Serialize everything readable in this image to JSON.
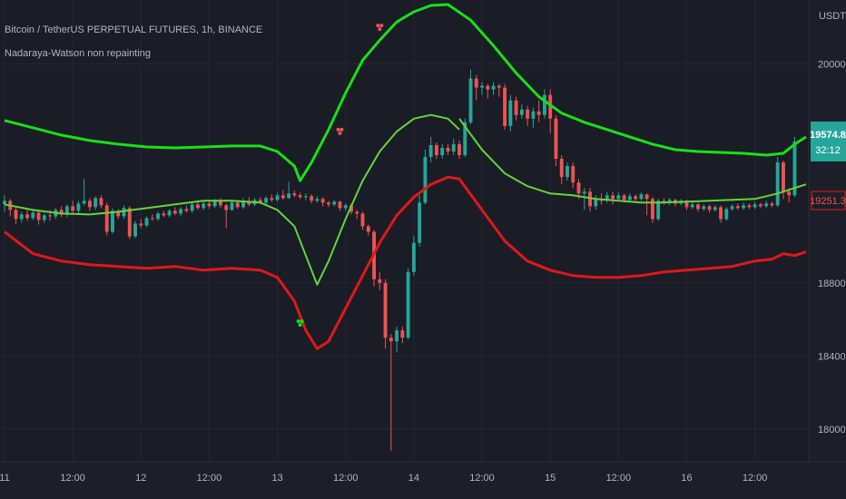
{
  "header": {
    "symbol_line": "Bitcoin / TetherUS PERPETUAL FUTURES, 1h, BINANCE",
    "indicator_name": "Nadaraya-Watson non repainting"
  },
  "price_axis": {
    "unit": "USDT",
    "ticks": [
      "20000.0",
      "18800.0",
      "18400.0",
      "18000.0"
    ],
    "tick_values": [
      20000,
      18800,
      18400,
      18000
    ],
    "last_price": "19574.8",
    "countdown": "32:12",
    "band_price": "19251.3"
  },
  "time_axis": {
    "labels": [
      "11",
      "12:00",
      "12",
      "12:00",
      "13",
      "12:00",
      "14",
      "12:00",
      "15",
      "12:00",
      "16",
      "12:00"
    ],
    "day_index": [
      0,
      12,
      24,
      36,
      48,
      60,
      72,
      84,
      96,
      108,
      120,
      132
    ]
  },
  "colors": {
    "background": "#1a1d26",
    "up_candle": "#26a69a",
    "down_candle": "#ef5350",
    "upper_band": "#18e018",
    "lower_band": "#e01818",
    "mid_line": "#61d63a",
    "last_price_badge": "#26a69a",
    "band_price_badge": "#e01818"
  },
  "chart_data": {
    "type": "candlestick",
    "ylim": [
      17820,
      20350
    ],
    "x_hours": [
      0,
      141
    ],
    "series": [
      {
        "name": "",
        "role": "upper",
        "points": [
          [
            0,
            19690
          ],
          [
            5,
            19650
          ],
          [
            10,
            19610
          ],
          [
            15,
            19580
          ],
          [
            20,
            19560
          ],
          [
            25,
            19545
          ],
          [
            30,
            19540
          ],
          [
            35,
            19545
          ],
          [
            40,
            19550
          ],
          [
            45,
            19550
          ],
          [
            48,
            19520
          ],
          [
            51,
            19440
          ],
          [
            52,
            19360
          ],
          [
            54,
            19460
          ],
          [
            57,
            19640
          ],
          [
            60,
            19840
          ],
          [
            63,
            20020
          ],
          [
            66,
            20130
          ],
          [
            69,
            20230
          ],
          [
            72,
            20285
          ],
          [
            75,
            20320
          ],
          [
            78,
            20325
          ],
          [
            82,
            20240
          ],
          [
            86,
            20100
          ],
          [
            90,
            19950
          ],
          [
            94,
            19820
          ],
          [
            98,
            19730
          ],
          [
            102,
            19680
          ],
          [
            106,
            19640
          ],
          [
            110,
            19600
          ],
          [
            114,
            19560
          ],
          [
            118,
            19530
          ],
          [
            122,
            19520
          ],
          [
            126,
            19515
          ],
          [
            130,
            19510
          ],
          [
            134,
            19500
          ],
          [
            137,
            19510
          ],
          [
            139,
            19560
          ],
          [
            141,
            19600
          ]
        ]
      },
      {
        "name": "",
        "role": "lower",
        "points": [
          [
            0,
            19080
          ],
          [
            5,
            18960
          ],
          [
            10,
            18920
          ],
          [
            15,
            18900
          ],
          [
            20,
            18890
          ],
          [
            25,
            18880
          ],
          [
            30,
            18890
          ],
          [
            35,
            18870
          ],
          [
            40,
            18880
          ],
          [
            45,
            18870
          ],
          [
            48,
            18830
          ],
          [
            51,
            18700
          ],
          [
            53,
            18540
          ],
          [
            55,
            18440
          ],
          [
            57,
            18480
          ],
          [
            60,
            18660
          ],
          [
            63,
            18840
          ],
          [
            66,
            19020
          ],
          [
            69,
            19170
          ],
          [
            72,
            19270
          ],
          [
            75,
            19340
          ],
          [
            78,
            19380
          ],
          [
            80,
            19370
          ],
          [
            84,
            19200
          ],
          [
            88,
            19030
          ],
          [
            92,
            18920
          ],
          [
            96,
            18870
          ],
          [
            100,
            18840
          ],
          [
            104,
            18830
          ],
          [
            108,
            18830
          ],
          [
            112,
            18840
          ],
          [
            116,
            18860
          ],
          [
            120,
            18870
          ],
          [
            124,
            18880
          ],
          [
            128,
            18890
          ],
          [
            132,
            18920
          ],
          [
            135,
            18930
          ],
          [
            137,
            18960
          ],
          [
            139,
            18950
          ],
          [
            141,
            18970
          ]
        ]
      },
      {
        "name": "",
        "role": "mid",
        "points": [
          [
            0,
            19230
          ],
          [
            5,
            19200
          ],
          [
            10,
            19180
          ],
          [
            15,
            19175
          ],
          [
            20,
            19190
          ],
          [
            25,
            19210
          ],
          [
            30,
            19230
          ],
          [
            35,
            19250
          ],
          [
            40,
            19250
          ],
          [
            45,
            19240
          ],
          [
            48,
            19200
          ],
          [
            51,
            19110
          ],
          [
            53,
            18950
          ],
          [
            55,
            18790
          ],
          [
            57,
            18920
          ],
          [
            60,
            19150
          ],
          [
            63,
            19360
          ],
          [
            66,
            19520
          ],
          [
            69,
            19630
          ],
          [
            72,
            19700
          ],
          [
            75,
            19720
          ],
          [
            78,
            19700
          ],
          [
            80,
            19640
          ]
        ]
      },
      {
        "name": "",
        "role": "mid",
        "points": [
          [
            80,
            19700
          ],
          [
            84,
            19530
          ],
          [
            88,
            19400
          ],
          [
            92,
            19330
          ],
          [
            96,
            19290
          ],
          [
            100,
            19280
          ],
          [
            104,
            19260
          ],
          [
            108,
            19250
          ],
          [
            112,
            19240
          ],
          [
            116,
            19240
          ],
          [
            120,
            19245
          ],
          [
            124,
            19250
          ],
          [
            128,
            19255
          ],
          [
            132,
            19260
          ],
          [
            136,
            19290
          ],
          [
            139,
            19320
          ],
          [
            141,
            19340
          ]
        ]
      }
    ],
    "candles": [
      [
        19232,
        19250,
        19280,
        19190
      ],
      [
        19250,
        19200,
        19260,
        19165
      ],
      [
        19200,
        19150,
        19220,
        19120
      ],
      [
        19150,
        19175,
        19190,
        19130
      ],
      [
        19175,
        19155,
        19210,
        19140
      ],
      [
        19155,
        19185,
        19200,
        19145
      ],
      [
        19185,
        19145,
        19195,
        19120
      ],
      [
        19145,
        19170,
        19180,
        19130
      ],
      [
        19170,
        19165,
        19200,
        19140
      ],
      [
        19165,
        19200,
        19210,
        19150
      ],
      [
        19200,
        19175,
        19220,
        19160
      ],
      [
        19175,
        19220,
        19230,
        19160
      ],
      [
        19220,
        19195,
        19250,
        19180
      ],
      [
        19195,
        19235,
        19250,
        19180
      ],
      [
        19235,
        19250,
        19370,
        19225
      ],
      [
        19250,
        19215,
        19265,
        19195
      ],
      [
        19215,
        19265,
        19275,
        19200
      ],
      [
        19265,
        19225,
        19280,
        19210
      ],
      [
        19225,
        19080,
        19240,
        19060
      ],
      [
        19080,
        19195,
        19210,
        19070
      ],
      [
        19195,
        19165,
        19205,
        19150
      ],
      [
        19165,
        19210,
        19225,
        19150
      ],
      [
        19210,
        19055,
        19220,
        19040
      ],
      [
        19055,
        19125,
        19140,
        19045
      ],
      [
        19125,
        19115,
        19150,
        19100
      ],
      [
        19115,
        19155,
        19165,
        19105
      ],
      [
        19155,
        19150,
        19175,
        19140
      ],
      [
        19150,
        19180,
        19190,
        19140
      ],
      [
        19180,
        19170,
        19195,
        19160
      ],
      [
        19170,
        19195,
        19205,
        19160
      ],
      [
        19195,
        19180,
        19215,
        19170
      ],
      [
        19180,
        19205,
        19215,
        19165
      ],
      [
        19205,
        19195,
        19225,
        19185
      ],
      [
        19195,
        19230,
        19240,
        19185
      ],
      [
        19230,
        19210,
        19245,
        19200
      ],
      [
        19210,
        19235,
        19250,
        19200
      ],
      [
        19235,
        19220,
        19255,
        19205
      ],
      [
        19220,
        19250,
        19260,
        19210
      ],
      [
        19250,
        19225,
        19265,
        19210
      ],
      [
        19225,
        19200,
        19235,
        19100
      ],
      [
        19200,
        19240,
        19250,
        19195
      ],
      [
        19240,
        19215,
        19255,
        19205
      ],
      [
        19215,
        19250,
        19265,
        19205
      ],
      [
        19250,
        19230,
        19270,
        19220
      ],
      [
        19230,
        19255,
        19265,
        19220
      ],
      [
        19255,
        19240,
        19270,
        19230
      ],
      [
        19240,
        19265,
        19275,
        19230
      ],
      [
        19265,
        19255,
        19285,
        19245
      ],
      [
        19255,
        19280,
        19295,
        19245
      ],
      [
        19280,
        19265,
        19310,
        19255
      ],
      [
        19265,
        19290,
        19355,
        19260
      ],
      [
        19290,
        19280,
        19305,
        19270
      ],
      [
        19280,
        19270,
        19295,
        19260
      ],
      [
        19270,
        19275,
        19290,
        19255
      ],
      [
        19275,
        19250,
        19285,
        19235
      ],
      [
        19250,
        19260,
        19275,
        19240
      ],
      [
        19260,
        19240,
        19270,
        19220
      ],
      [
        19240,
        19230,
        19250,
        19215
      ],
      [
        19230,
        19245,
        19255,
        19220
      ],
      [
        19245,
        19210,
        19250,
        19195
      ],
      [
        19210,
        19225,
        19235,
        19195
      ],
      [
        19225,
        19190,
        19235,
        19175
      ],
      [
        19190,
        19180,
        19200,
        19150
      ],
      [
        19180,
        19110,
        19190,
        19090
      ],
      [
        19110,
        19080,
        19120,
        19060
      ],
      [
        19080,
        18820,
        19090,
        18780
      ],
      [
        18820,
        18800,
        18860,
        18760
      ],
      [
        18800,
        18500,
        18820,
        18440
      ],
      [
        18500,
        18480,
        18520,
        17880
      ],
      [
        18480,
        18540,
        18560,
        18420
      ],
      [
        18540,
        18500,
        18560,
        18470
      ],
      [
        18500,
        18860,
        18880,
        18490
      ],
      [
        18860,
        19020,
        19060,
        18840
      ],
      [
        19020,
        19240,
        19280,
        19000
      ],
      [
        19240,
        19490,
        19530,
        19230
      ],
      [
        19490,
        19555,
        19600,
        19460
      ],
      [
        19555,
        19500,
        19570,
        19480
      ],
      [
        19500,
        19540,
        19560,
        19480
      ],
      [
        19540,
        19520,
        19560,
        19500
      ],
      [
        19520,
        19560,
        19590,
        19500
      ],
      [
        19560,
        19500,
        19580,
        19480
      ],
      [
        19500,
        19680,
        19700,
        19490
      ],
      [
        19680,
        19920,
        19970,
        19670
      ],
      [
        19920,
        19870,
        19940,
        19800
      ],
      [
        19870,
        19880,
        19900,
        19830
      ],
      [
        19880,
        19860,
        19890,
        19810
      ],
      [
        19860,
        19880,
        19900,
        19830
      ],
      [
        19880,
        19870,
        19890,
        19820
      ],
      [
        19870,
        19660,
        19890,
        19640
      ],
      [
        19660,
        19800,
        19830,
        19630
      ],
      [
        19800,
        19720,
        19820,
        19690
      ],
      [
        19720,
        19750,
        19780,
        19700
      ],
      [
        19750,
        19700,
        19770,
        19660
      ],
      [
        19700,
        19740,
        19760,
        19650
      ],
      [
        19740,
        19720,
        19800,
        19680
      ],
      [
        19720,
        19830,
        19860,
        19700
      ],
      [
        19830,
        19700,
        19860,
        19620
      ],
      [
        19700,
        19480,
        19720,
        19440
      ],
      [
        19480,
        19380,
        19500,
        19340
      ],
      [
        19380,
        19440,
        19460,
        19360
      ],
      [
        19440,
        19350,
        19460,
        19320
      ],
      [
        19350,
        19290,
        19370,
        19260
      ],
      [
        19290,
        19300,
        19320,
        19200
      ],
      [
        19300,
        19220,
        19320,
        19190
      ],
      [
        19220,
        19260,
        19280,
        19200
      ],
      [
        19260,
        19250,
        19290,
        19230
      ],
      [
        19250,
        19280,
        19300,
        19240
      ],
      [
        19280,
        19260,
        19300,
        19230
      ],
      [
        19260,
        19280,
        19295,
        19250
      ],
      [
        19280,
        19255,
        19290,
        19240
      ],
      [
        19255,
        19275,
        19290,
        19245
      ],
      [
        19275,
        19260,
        19285,
        19250
      ],
      [
        19260,
        19285,
        19295,
        19250
      ],
      [
        19285,
        19260,
        19290,
        19170
      ],
      [
        19260,
        19150,
        19270,
        19130
      ],
      [
        19150,
        19250,
        19260,
        19140
      ],
      [
        19250,
        19240,
        19265,
        19230
      ],
      [
        19240,
        19255,
        19265,
        19225
      ],
      [
        19255,
        19235,
        19260,
        19220
      ],
      [
        19235,
        19250,
        19260,
        19225
      ],
      [
        19250,
        19215,
        19255,
        19200
      ],
      [
        19215,
        19230,
        19240,
        19205
      ],
      [
        19230,
        19205,
        19240,
        19190
      ],
      [
        19205,
        19220,
        19230,
        19195
      ],
      [
        19220,
        19200,
        19230,
        19185
      ],
      [
        19200,
        19215,
        19225,
        19190
      ],
      [
        19215,
        19150,
        19225,
        19130
      ],
      [
        19150,
        19205,
        19215,
        19140
      ],
      [
        19205,
        19220,
        19230,
        19195
      ],
      [
        19220,
        19210,
        19235,
        19200
      ],
      [
        19210,
        19225,
        19240,
        19200
      ],
      [
        19225,
        19215,
        19235,
        19205
      ],
      [
        19215,
        19230,
        19245,
        19205
      ],
      [
        19230,
        19220,
        19240,
        19210
      ],
      [
        19220,
        19235,
        19250,
        19210
      ],
      [
        19235,
        19225,
        19245,
        19215
      ],
      [
        19225,
        19460,
        19490,
        19215
      ],
      [
        19460,
        19300,
        19470,
        19260
      ],
      [
        19300,
        19280,
        19320,
        19240
      ],
      [
        19280,
        19575,
        19600,
        19270
      ]
    ],
    "markers": [
      {
        "x": 66,
        "y": 20210,
        "kind": "sell",
        "color": "#ef5350"
      },
      {
        "x": 59,
        "y": 19640,
        "kind": "sell",
        "color": "#ef5350"
      },
      {
        "x": 52,
        "y": 18590,
        "kind": "buy",
        "color": "#18e018"
      },
      {
        "x": 53,
        "y": 17780,
        "kind": "buy",
        "color": "#18e018"
      }
    ]
  }
}
